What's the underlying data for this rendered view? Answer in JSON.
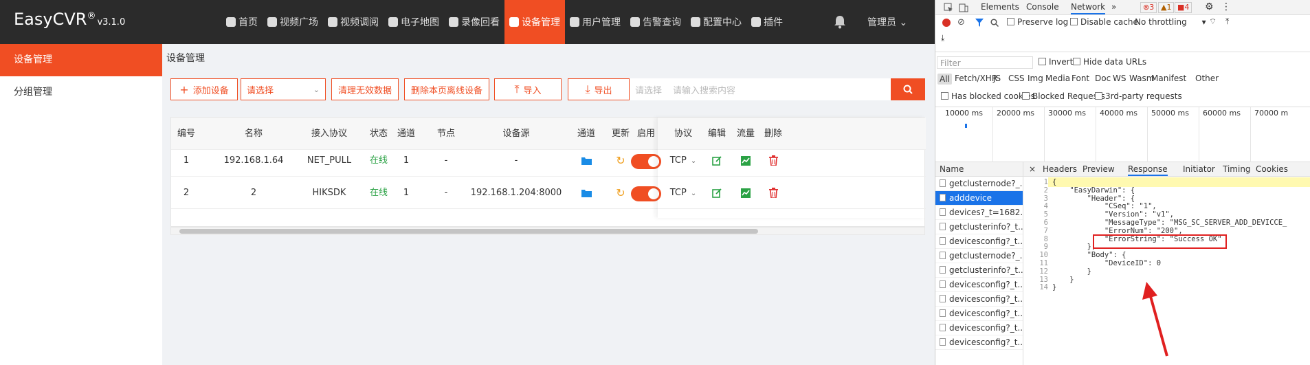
{
  "app": {
    "logo": "EasyCVR",
    "logo_reg": "®",
    "version": "v3.1.0"
  },
  "nav": [
    {
      "label": "首页",
      "icon": "home-icon"
    },
    {
      "label": "视频广场",
      "icon": "play-icon"
    },
    {
      "label": "视频调阅",
      "icon": "grid-icon"
    },
    {
      "label": "电子地图",
      "icon": "map-pin-icon"
    },
    {
      "label": "录像回看",
      "icon": "video-camera-icon"
    },
    {
      "label": "设备管理",
      "icon": "device-icon",
      "active": true
    },
    {
      "label": "用户管理",
      "icon": "user-icon"
    },
    {
      "label": "告警查询",
      "icon": "alarm-icon"
    },
    {
      "label": "配置中心",
      "icon": "gear-icon"
    },
    {
      "label": "插件",
      "icon": "puzzle-icon"
    }
  ],
  "user": {
    "label": "管理员 ⌄"
  },
  "sidebar": [
    {
      "label": "设备管理",
      "active": true
    },
    {
      "label": "分组管理"
    }
  ],
  "breadcrumb": "设备管理",
  "toolbar": {
    "add": "添加设备",
    "select": "请选择",
    "clear": "清理无效数据",
    "delete_offline": "删除本页离线设备",
    "import": "导入",
    "export": "导出",
    "search_select": "请选择",
    "search_placeholder": "请输入搜索内容"
  },
  "table": {
    "headers": [
      "编号",
      "名称",
      "接入协议",
      "状态",
      "通道",
      "节点",
      "设备源",
      "通道",
      "更新",
      "启用",
      "协议",
      "编辑",
      "流量",
      "删除"
    ],
    "rows": [
      {
        "id": "1",
        "name": "192.168.1.64",
        "protocol": "NET_PULL",
        "status": "在线",
        "channels": "1",
        "node": "-",
        "source": "-",
        "proto": "TCP"
      },
      {
        "id": "2",
        "name": "2",
        "protocol": "HIKSDK",
        "status": "在线",
        "channels": "1",
        "node": "-",
        "source": "192.168.1.204:8000",
        "proto": "TCP"
      }
    ]
  },
  "devtools": {
    "tabs": [
      "Elements",
      "Console",
      "Network",
      "»"
    ],
    "active_tab": "Network",
    "badges": [
      "3",
      "1",
      "4"
    ],
    "toolbar": {
      "preserve_log": "Preserve log",
      "disable_cache": "Disable cache",
      "throttling": "No throttling"
    },
    "filter": {
      "placeholder": "Filter",
      "invert": "Invert",
      "hide_data": "Hide data URLs",
      "types": [
        "All",
        "Fetch/XHR",
        "JS",
        "CSS",
        "Img",
        "Media",
        "Font",
        "Doc",
        "WS",
        "Wasm",
        "Manifest",
        "Other"
      ],
      "has_blocked_cookies": "Has blocked cookies",
      "blocked_requests": "Blocked Requests",
      "third_party": "3rd-party requests"
    },
    "timeline": [
      "10000 ms",
      "20000 ms",
      "30000 ms",
      "40000 ms",
      "50000 ms",
      "60000 ms",
      "70000 m"
    ],
    "name_header": "Name",
    "requests": [
      "getclusternode?_...",
      "adddevice",
      "devices?_t=1682...",
      "getclusterinfo?_t...",
      "devicesconfig?_t...",
      "getclusternode?_...",
      "getclusterinfo?_t...",
      "devicesconfig?_t...",
      "devicesconfig?_t...",
      "devicesconfig?_t...",
      "devicesconfig?_t...",
      "devicesconfig?_t..."
    ],
    "selected_request": 1,
    "detail_tabs": [
      "×",
      "Headers",
      "Preview",
      "Response",
      "Initiator",
      "Timing",
      "Cookies"
    ],
    "active_detail_tab": "Response",
    "code_lines": [
      "{",
      "    \"EasyDarwin\": {",
      "        \"Header\": {",
      "            \"CSeq\": \"1\",",
      "            \"Version\": \"v1\",",
      "            \"MessageType\": \"MSG_SC_SERVER_ADD_DEVICCE_",
      "            \"ErrorNum\": \"200\",",
      "            \"ErrorString\": \"Success OK\"",
      "        },",
      "        \"Body\": {",
      "            \"DeviceID\": 0",
      "        }",
      "    }",
      "}"
    ]
  }
}
